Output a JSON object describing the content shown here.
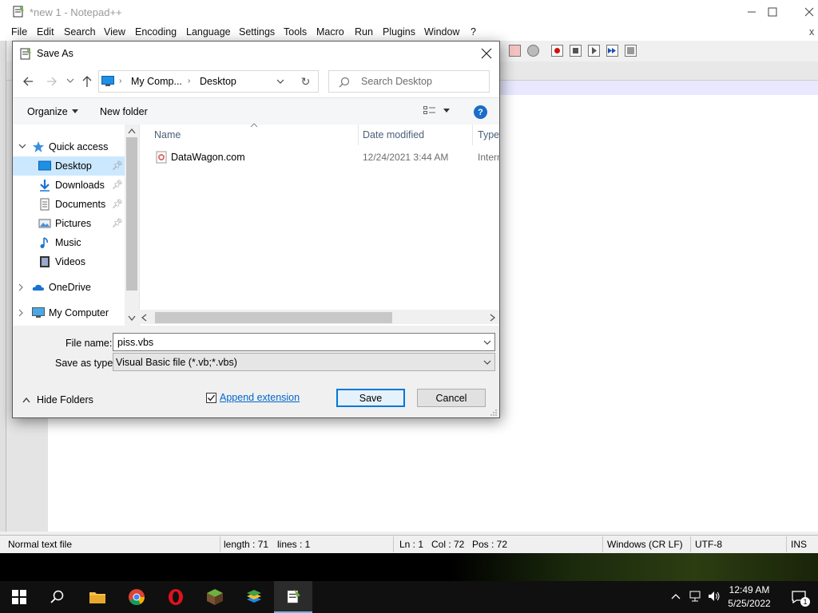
{
  "notepad": {
    "title": "*new 1 - Notepad++",
    "menu": [
      "File",
      "Edit",
      "Search",
      "View",
      "Encoding",
      "Language",
      "Settings",
      "Tools",
      "Macro",
      "Run",
      "Plugins",
      "Window",
      "?"
    ],
    "close_x": "x",
    "status": {
      "doc_type": "Normal text file",
      "length": "length : 71",
      "lines": "lines : 1",
      "ln": "Ln : 1",
      "col": "Col : 72",
      "pos": "Pos : 72",
      "eol": "Windows (CR LF)",
      "encoding": "UTF-8",
      "mode": "INS"
    }
  },
  "dialog": {
    "title": "Save As",
    "address": {
      "segments": [
        "My Comp...",
        "Desktop"
      ]
    },
    "search_placeholder": "Search Desktop",
    "toolbar": {
      "organize": "Organize",
      "new_folder": "New folder"
    },
    "nav": [
      {
        "label": "Quick access",
        "icon": "star-icon"
      },
      {
        "label": "Desktop",
        "icon": "desktop-icon",
        "pinned": true,
        "selected": true
      },
      {
        "label": "Downloads",
        "icon": "download-icon",
        "pinned": true
      },
      {
        "label": "Documents",
        "icon": "documents-icon",
        "pinned": true
      },
      {
        "label": "Pictures",
        "icon": "pictures-icon",
        "pinned": true
      },
      {
        "label": "Music",
        "icon": "music-icon"
      },
      {
        "label": "Videos",
        "icon": "videos-icon"
      },
      {
        "label": "OneDrive",
        "icon": "cloud-icon"
      },
      {
        "label": "My Computer",
        "icon": "computer-icon"
      }
    ],
    "columns": {
      "name": "Name",
      "date": "Date modified",
      "type": "Type"
    },
    "files": [
      {
        "name": "DataWagon.com",
        "date": "12/24/2021 3:44 AM",
        "type": "Intern"
      }
    ],
    "file_name_label": "File name:",
    "file_name_value": "piss.vbs",
    "save_type_label": "Save as type:",
    "save_type_value": "Visual Basic file (*.vb;*.vbs)",
    "hide_folders": "Hide Folders",
    "append_extension": "Append extension",
    "append_checked": true,
    "save": "Save",
    "cancel": "Cancel"
  },
  "taskbar": {
    "time": "12:49 AM",
    "date": "5/25/2022",
    "notification_count": "1"
  },
  "colors": {
    "accent": "#0078d7",
    "selection": "#cce8ff",
    "title_inactive": "#9a9a9a"
  }
}
